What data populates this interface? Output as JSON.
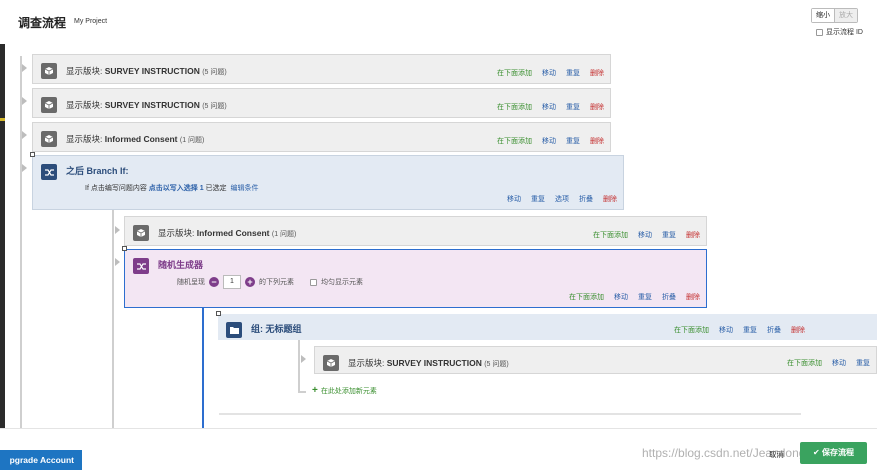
{
  "header": {
    "title": "调查流程",
    "project": "My Project",
    "zoom_out": "缩小",
    "zoom_in": "放大",
    "show_flow_id": "显示流程 ID"
  },
  "blocks": [
    {
      "prefix": "显示版块:",
      "name": "SURVEY INSTRUCTION",
      "count": "(5 问题)"
    },
    {
      "prefix": "显示版块:",
      "name": "SURVEY INSTRUCTION",
      "count": "(5 问题)"
    },
    {
      "prefix": "显示版块:",
      "name": "Informed Consent",
      "count": "(1 问题)"
    }
  ],
  "actions": {
    "add_below": "在下面添加",
    "move": "移动",
    "duplicate": "重复",
    "delete": "删除",
    "options": "选项",
    "collapse": "折叠"
  },
  "branch": {
    "title": "之后 Branch If:",
    "cond_if": "If",
    "cond_text": "点击编写问题内容",
    "cond_link": "点击以写入选择 1",
    "cond_selected": "已选定",
    "edit_condition": "编辑条件"
  },
  "nested_block": {
    "prefix": "显示版块:",
    "name": "Informed Consent",
    "count": "(1 问题)"
  },
  "randomizer": {
    "title": "随机生成器",
    "present_label": "随机呈现",
    "minus": "−",
    "value": "1",
    "plus": "+",
    "suffix": "的下列元素",
    "even_label": "均匀显示元素"
  },
  "group": {
    "title": "组: 无标题组"
  },
  "inner_block": {
    "prefix": "显示版块:",
    "name": "SURVEY INSTRUCTION",
    "count": "(5 问题)"
  },
  "add_new_element": "在此处添加新元素",
  "footer": {
    "upgrade": "pgrade Account",
    "cancel": "取消",
    "save": "保存流程",
    "watermark": "https://blog.csdn.net/Jeandong"
  },
  "colors": {
    "green": "#3a8f2f",
    "blue": "#2a5fa8",
    "red": "#c42d2d",
    "save_green": "#3aa35f",
    "upgrade_blue": "#1e75c2",
    "randomizer_purple": "#7e3d8a",
    "branch_navy": "#2c4d7b"
  }
}
